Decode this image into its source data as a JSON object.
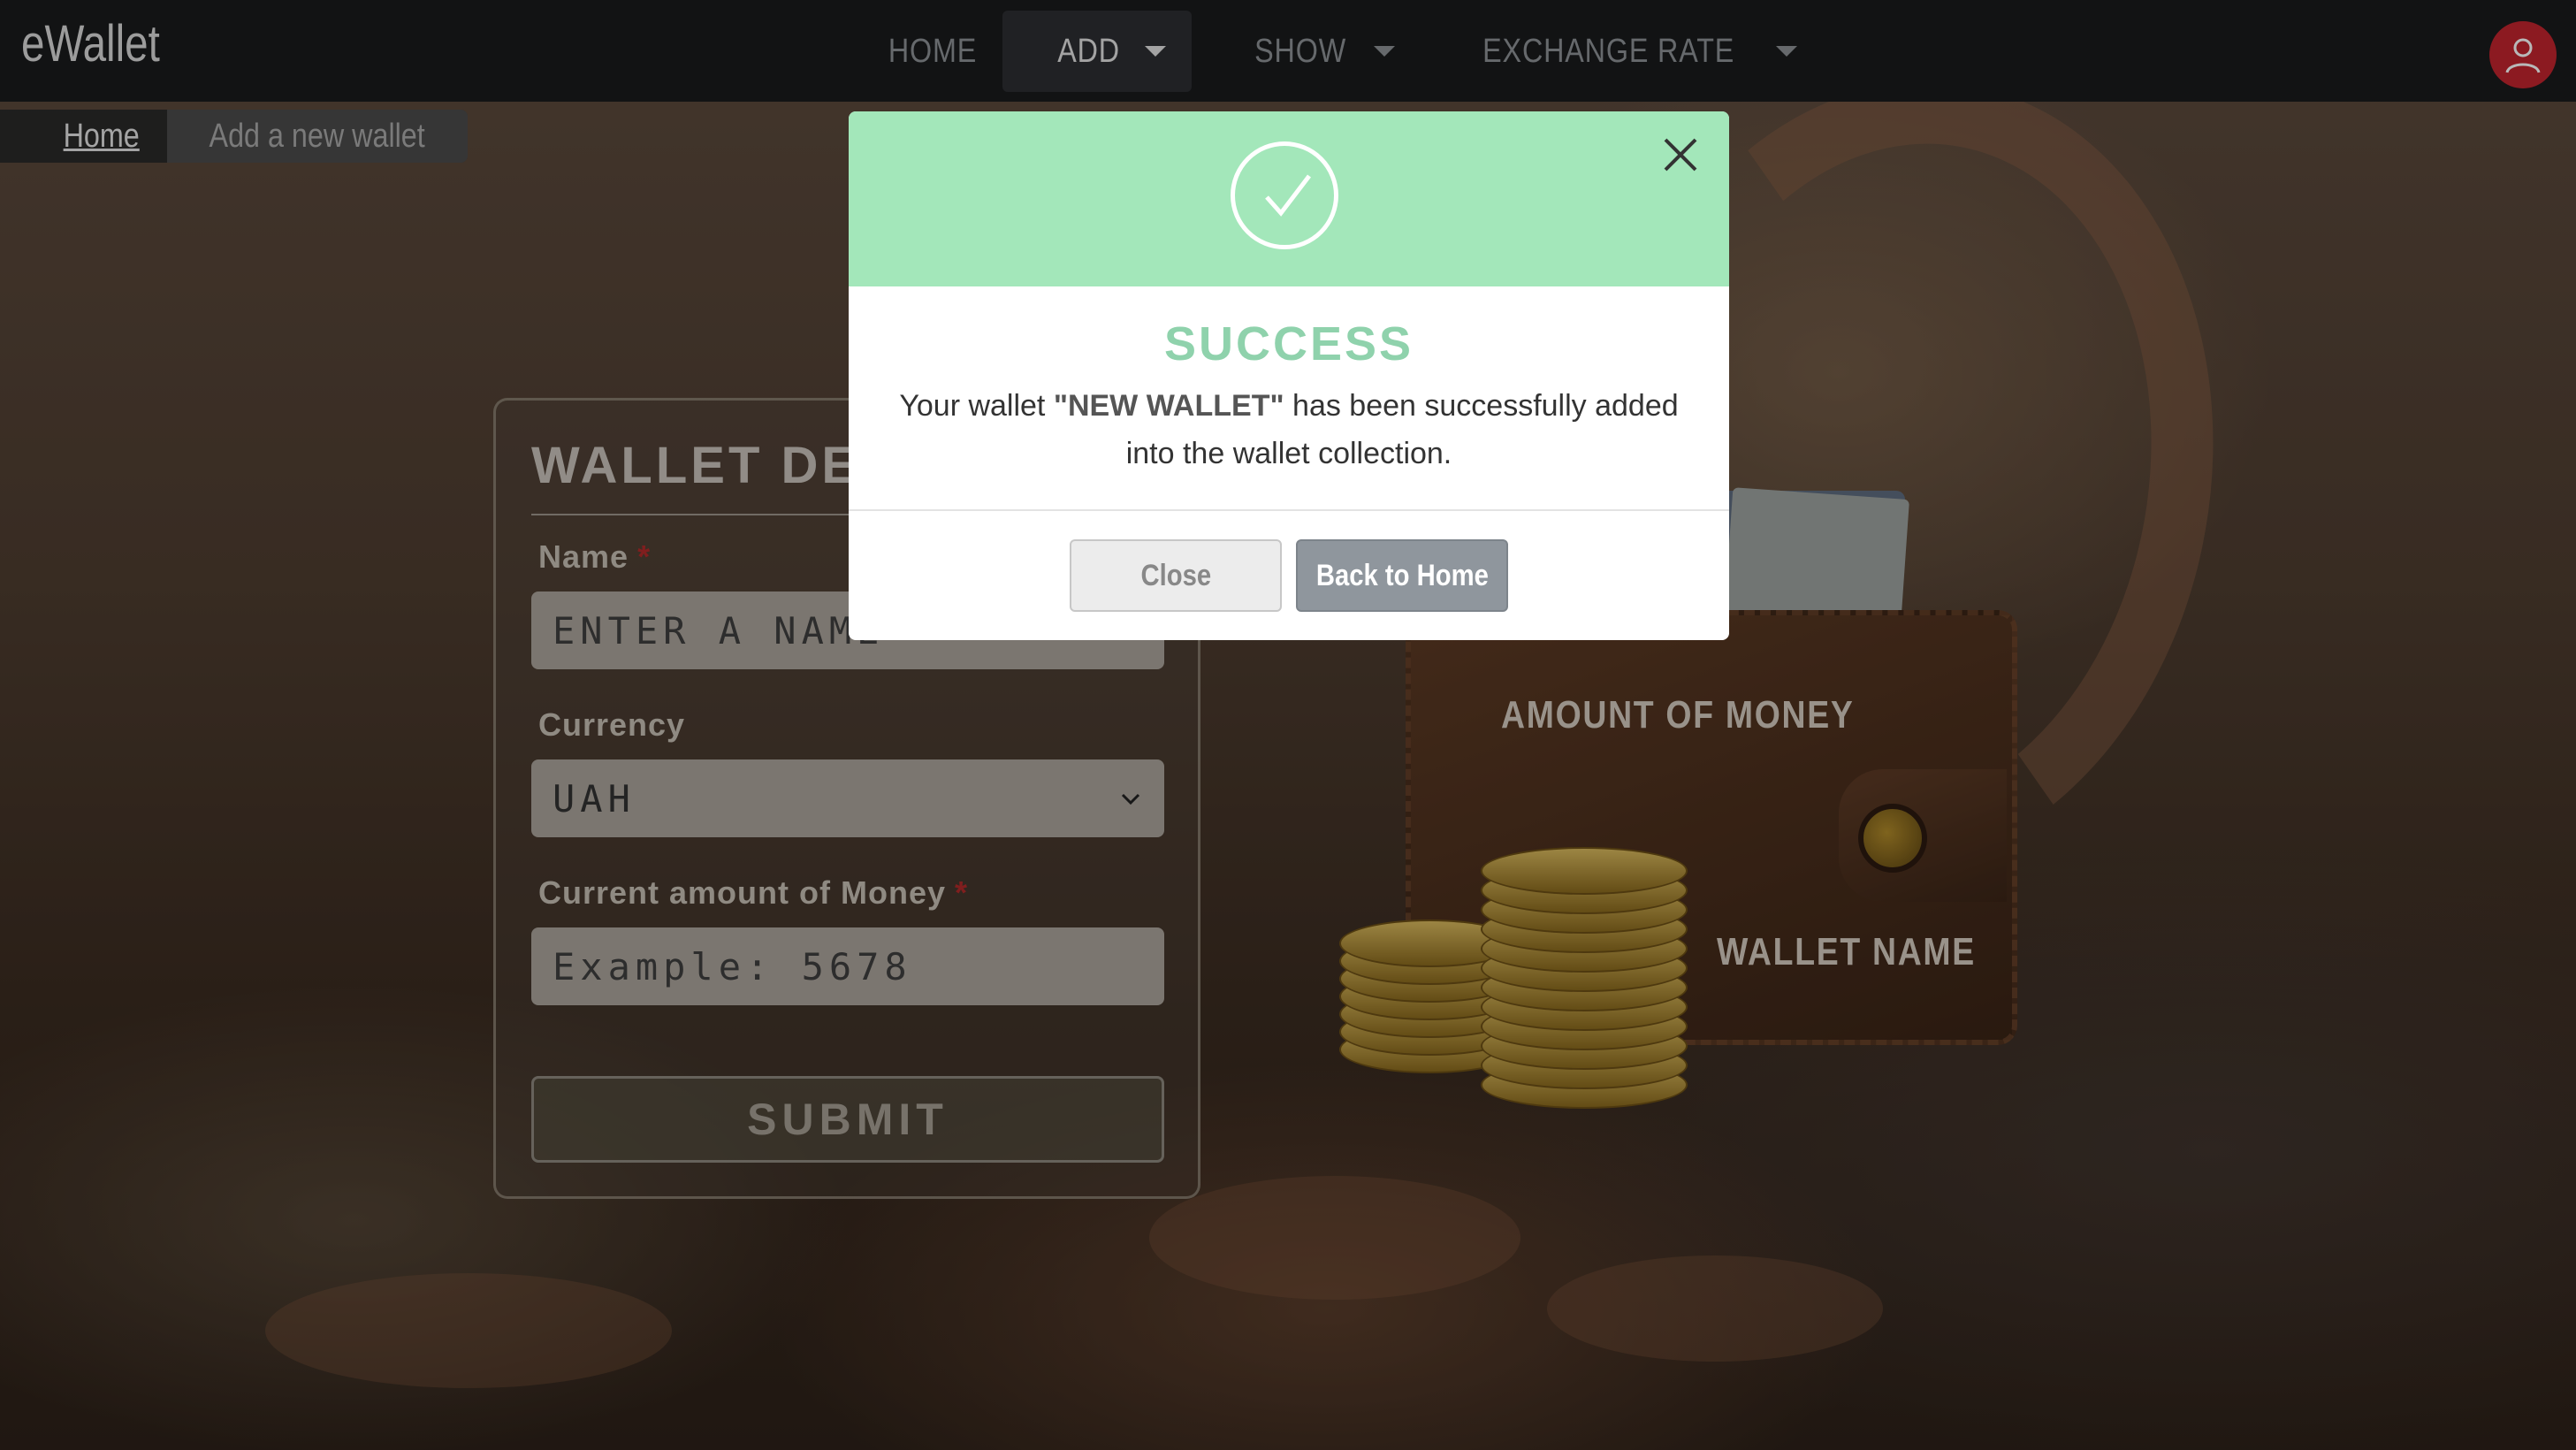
{
  "navbar": {
    "brand": "eWallet",
    "items": [
      {
        "label": "HOME",
        "dropdown": false
      },
      {
        "label": "ADD",
        "dropdown": true,
        "active": true
      },
      {
        "label": "SHOW",
        "dropdown": true
      },
      {
        "label": "EXCHANGE RATE",
        "dropdown": true
      }
    ],
    "avatar_icon": "user-icon",
    "avatar_color": "#c2242f"
  },
  "breadcrumb": {
    "home": "Home",
    "current": "Add a new wallet"
  },
  "form": {
    "title": "WALLET DE",
    "name_label": "Name",
    "required_mark": "*",
    "name_placeholder": "ENTER A NAME",
    "currency_label": "Currency",
    "currency_value": "UAH",
    "amount_label": "Current amount of Money",
    "amount_placeholder": "Example: 5678",
    "submit_label": "SUBMIT"
  },
  "wallet_preview": {
    "amount_label": "AMOUNT OF MONEY",
    "name_label": "WALLET NAME"
  },
  "modal": {
    "header_color": "#a3e7ba",
    "icon": "check-circle-icon",
    "close_icon": "close-icon",
    "title": "SUCCESS",
    "message_prefix": "Your wallet ",
    "wallet_name": "\"NEW WALLET\"",
    "message_suffix": " has been successfully added into the wallet collection.",
    "close_button": "Close",
    "home_button": "Back to Home"
  }
}
